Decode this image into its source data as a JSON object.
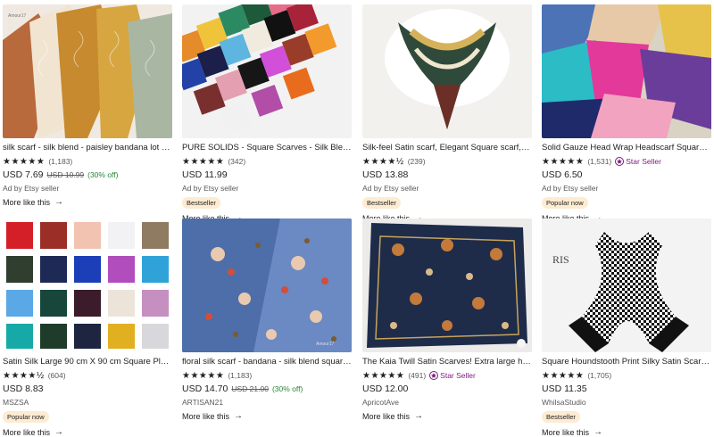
{
  "listings": [
    {
      "title": "silk scarf - silk blend - paisley bandana lot - squ...",
      "stars": "★★★★★",
      "count": "(1,183)",
      "price": "USD 7.69",
      "orig": "USD 10.99",
      "discount": "(30% off)",
      "seller": "Ad by Etsy seller",
      "more": "More like this",
      "arrow": "→",
      "watermark": "Amour17"
    },
    {
      "title": "PURE SOLIDS - Square Scarves - Silk Blend Hea...",
      "stars": "★★★★★",
      "count": "(342)",
      "price": "USD 11.99",
      "seller": "Ad by Etsy seller",
      "badge": "Bestseller",
      "more": "More like this",
      "arrow": "→"
    },
    {
      "title": "Silk-feel Satin scarf, Elegant Square scarf,hair t...",
      "stars": "★★★★½",
      "count": "(239)",
      "price": "USD 13.88",
      "seller": "Ad by Etsy seller",
      "badge": "Bestseller",
      "more": "More like this",
      "arrow": "→"
    },
    {
      "title": "Solid Gauze Head Wrap Headscarf Square Sca...",
      "stars": "★★★★★",
      "count": "(1,531)",
      "star_seller": "Star Seller",
      "price": "USD 6.50",
      "seller": "Ad by Etsy seller",
      "badge": "Popular now",
      "more": "More like this",
      "arrow": "→"
    },
    {
      "title": "Satin Silk Large 90 cm X 90 cm Square Plain N...",
      "stars": "★★★★½",
      "count": "(604)",
      "price": "USD 8.83",
      "seller": "MSZSA",
      "badge": "Popular now",
      "more": "More like this",
      "arrow": "→"
    },
    {
      "title": "floral silk scarf - bandana - silk blend square sc...",
      "stars": "★★★★★",
      "count": "(1,183)",
      "price": "USD 14.70",
      "orig": "USD 21.00",
      "discount": "(30% off)",
      "seller": "ARTISAN21",
      "more": "More like this",
      "arrow": "→",
      "watermark": "Amour17"
    },
    {
      "title": "The Kaia Twill Satin Scarves! Extra large head o...",
      "stars": "★★★★★",
      "count": "(491)",
      "star_seller": "Star Seller",
      "price": "USD 12.00",
      "seller": "ApricotAve",
      "more": "More like this",
      "arrow": "→"
    },
    {
      "title": "Square Houndstooth Print Silky Satin Scarf, Ha...",
      "stars": "★★★★★",
      "count": "(1,705)",
      "price": "USD 11.35",
      "seller": "WhilsaStudio",
      "badge": "Bestseller",
      "more": "More like this",
      "arrow": "→",
      "image_text": "RIS"
    }
  ],
  "colors": {
    "price_discount": "#258635",
    "star_seller": "#7f187f",
    "badge_bg": "#fdebd2"
  }
}
